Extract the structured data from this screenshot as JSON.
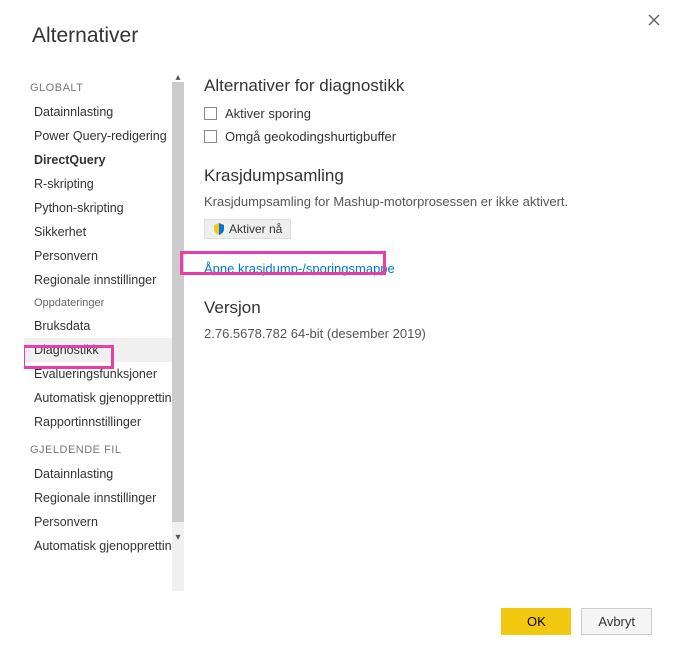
{
  "dialog": {
    "title": "Alternativer"
  },
  "sidebar": {
    "section1": "GLOBALT",
    "items1": [
      "Datainnlasting",
      "Power Query-redigering",
      "DirectQuery",
      "R-skripting",
      "Python-skripting",
      "Sikkerhet",
      "Personvern",
      "Regionale innstillinger",
      "Oppdateringer",
      "Bruksdata",
      "Diagnostikk",
      "Evalueringsfunksjoner",
      "Automatisk gjenoppretting",
      "Rapportinnstillinger"
    ],
    "section2": "GJELDENDE FIL",
    "items2": [
      "Datainnlasting",
      "Regionale innstillinger",
      "Personvern",
      "Automatisk gjenoppretting"
    ]
  },
  "main": {
    "diag_heading": "Alternativer for diagnostikk",
    "enable_tracing": "Aktiver sporing",
    "bypass_geo": "Omgå geokodingshurtigbuffer",
    "crashdump_heading": "Krasjdumpsamling",
    "crashdump_text": "Krasjdumpsamling for Mashup-motorprosessen er ikke aktivert.",
    "enable_now": "Aktiver nå",
    "open_folder_link": "Åpne krasjdump-/sporingsmappe",
    "version_heading": "Versjon",
    "version_text": "2.76.5678.782 64-bit (desember 2019)"
  },
  "buttons": {
    "ok": "OK",
    "cancel": "Avbryt"
  }
}
